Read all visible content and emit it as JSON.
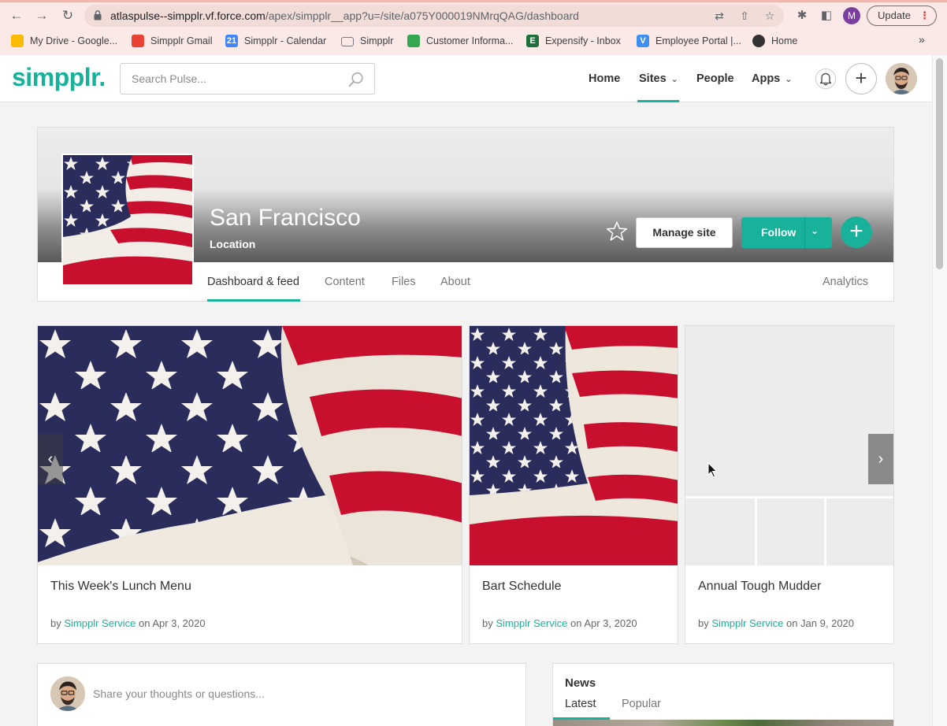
{
  "browser": {
    "url_host": "atlaspulse--simpplr.vf.force.com",
    "url_path": "/apex/simpplr__app?u=/site/a075Y000019NMrqQAG/dashboard",
    "profile_initial": "M",
    "update_label": "Update",
    "bookmarks": [
      {
        "label": "My Drive - Google...",
        "icon": "google-drive-icon",
        "color": "#fbbc04"
      },
      {
        "label": "Simpplr Gmail",
        "icon": "gmail-icon",
        "color": "#ea4335"
      },
      {
        "label": "Simpplr - Calendar",
        "icon": "calendar-icon",
        "color": "#4285f4",
        "glyph": "21"
      },
      {
        "label": "Simpplr",
        "icon": "folder-icon",
        "color": "#7a7a7a"
      },
      {
        "label": "Customer Informa...",
        "icon": "google-drive-icon",
        "color": "#34a853"
      },
      {
        "label": "Expensify - Inbox",
        "icon": "expensify-icon",
        "color": "#1c6f3b",
        "glyph": "E"
      },
      {
        "label": "Employee Portal |...",
        "icon": "portal-icon",
        "color": "#3f8ef0",
        "glyph": "V"
      },
      {
        "label": "Home",
        "icon": "globe-icon",
        "color": "#333333"
      }
    ]
  },
  "header": {
    "logo": "simpplr.",
    "search_placeholder": "Search Pulse...",
    "nav": {
      "home": "Home",
      "sites": "Sites",
      "people": "People",
      "apps": "Apps"
    },
    "active_nav": "Sites"
  },
  "site": {
    "title": "San Francisco",
    "type": "Location",
    "manage_label": "Manage site",
    "follow_label": "Follow",
    "tabs": {
      "dashboard": "Dashboard & feed",
      "content": "Content",
      "files": "Files",
      "about": "About",
      "analytics": "Analytics"
    },
    "active_tab": "Dashboard & feed"
  },
  "carousel": [
    {
      "title": "This Week's Lunch Menu",
      "by": "by ",
      "author": "Simpplr Service",
      "date": " on Apr 3, 2020"
    },
    {
      "title": "Bart Schedule",
      "by": "by ",
      "author": "Simpplr Service",
      "date": " on Apr 3, 2020"
    },
    {
      "title": "Annual Tough Mudder",
      "by": "by ",
      "author": "Simpplr Service",
      "date": " on Jan 9, 2020"
    }
  ],
  "feed": {
    "share_placeholder": "Share your thoughts or questions..."
  },
  "news": {
    "title": "News",
    "tabs": {
      "latest": "Latest",
      "popular": "Popular"
    },
    "active_tab": "Latest"
  },
  "colors": {
    "brand": "#18b29a",
    "chrome": "#fbe9e7",
    "flag_red": "#c8102e",
    "flag_blue": "#2a2d5c"
  }
}
